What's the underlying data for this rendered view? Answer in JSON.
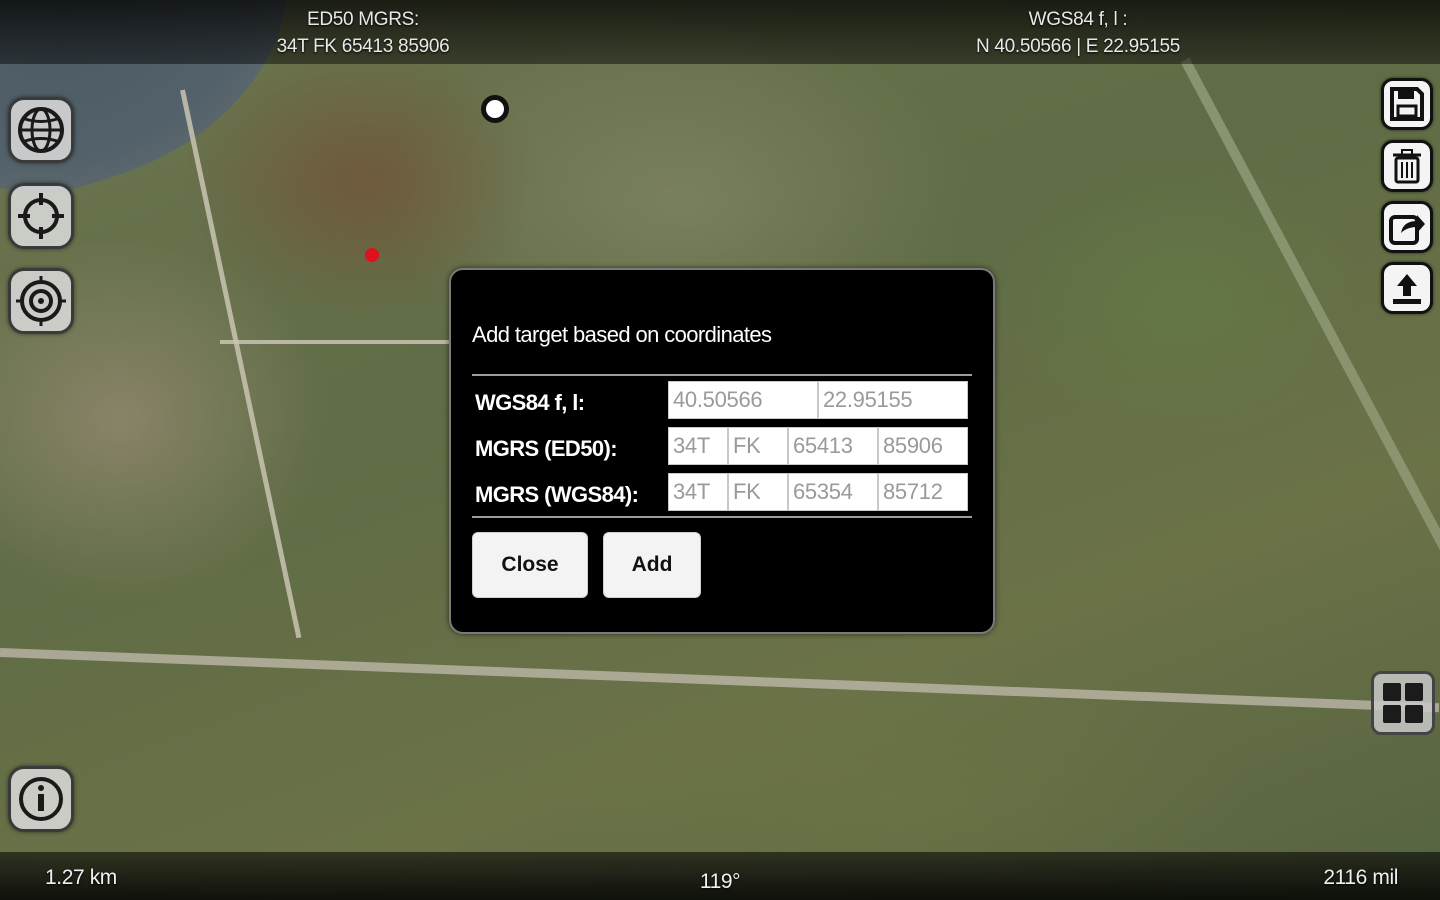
{
  "topbar": {
    "left_title": "ED50 MGRS:",
    "left_value": "34T FK 65413 85906",
    "right_title": "WGS84 f, l :",
    "right_value": "N 40.50566 | E 22.95155"
  },
  "bottombar": {
    "scale": "1.27 km",
    "heading": "119°",
    "distance_mil": "2116 mil"
  },
  "left_tools": {
    "globe_icon": "globe-icon",
    "locate_icon": "crosshair-icon",
    "target_icon": "target-icon",
    "info_icon": "info-icon"
  },
  "right_tools": {
    "save_icon": "floppy-disk-icon",
    "delete_icon": "trash-icon",
    "share_icon": "share-icon",
    "upload_icon": "upload-icon",
    "grid_icon": "grid-icon"
  },
  "dialog": {
    "title": "Add target based on coordinates",
    "rows": [
      {
        "label": "WGS84 f, l:",
        "fields": [
          "40.50566",
          "22.95155"
        ]
      },
      {
        "label": "MGRS (ED50):",
        "fields": [
          "34T",
          "FK",
          "65413",
          "85906"
        ]
      },
      {
        "label": "MGRS (WGS84):",
        "fields": [
          "34T",
          "FK",
          "65354",
          "85712"
        ]
      }
    ],
    "close_label": "Close",
    "add_label": "Add"
  },
  "colors": {
    "dialog_bg": "#000000",
    "marker_red": "#e0111b",
    "marker_white": "#ffffff"
  }
}
